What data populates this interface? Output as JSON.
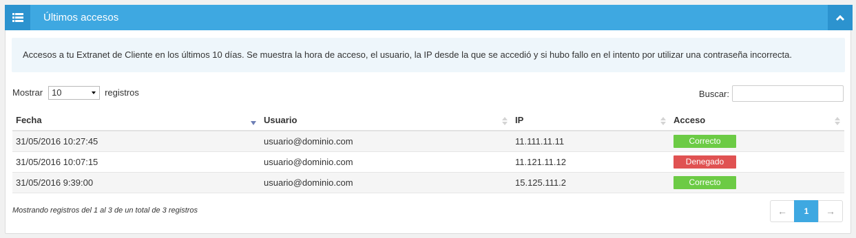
{
  "panel": {
    "title": "Últimos accesos",
    "header_icon": "list-icon",
    "collapse_icon": "chevron-up-icon",
    "accent_color": "#3ea8e1"
  },
  "info": {
    "text": "Accesos a tu Extranet de Cliente en los últimos 10 días. Se muestra la hora de acceso, el usuario, la IP desde la que se accedió y si hubo fallo en el intento por utilizar una contraseña incorrecta."
  },
  "length_control": {
    "label_before": "Mostrar",
    "selected": "10",
    "label_after": "registros"
  },
  "search": {
    "label": "Buscar:",
    "value": ""
  },
  "table": {
    "columns": [
      "Fecha",
      "Usuario",
      "IP",
      "Acceso"
    ],
    "rows": [
      {
        "fecha": "31/05/2016 10:27:45",
        "usuario": "usuario@dominio.com",
        "ip": "11.111.11.11",
        "acceso": "Correcto"
      },
      {
        "fecha": "31/05/2016 10:07:15",
        "usuario": "usuario@dominio.com",
        "ip": "11.121.11.12",
        "acceso": "Denegado"
      },
      {
        "fecha": "31/05/2016 9:39:00",
        "usuario": "usuario@dominio.com",
        "ip": "15.125.111.2",
        "acceso": "Correcto"
      }
    ],
    "badge_colors": {
      "Correcto": "#6ccb45",
      "Denegado": "#e05252"
    }
  },
  "footer": {
    "info": "Mostrando registros del 1 al 3 de un total de 3 registros",
    "pagination": {
      "prev": "←",
      "current": "1",
      "next": "→"
    }
  }
}
